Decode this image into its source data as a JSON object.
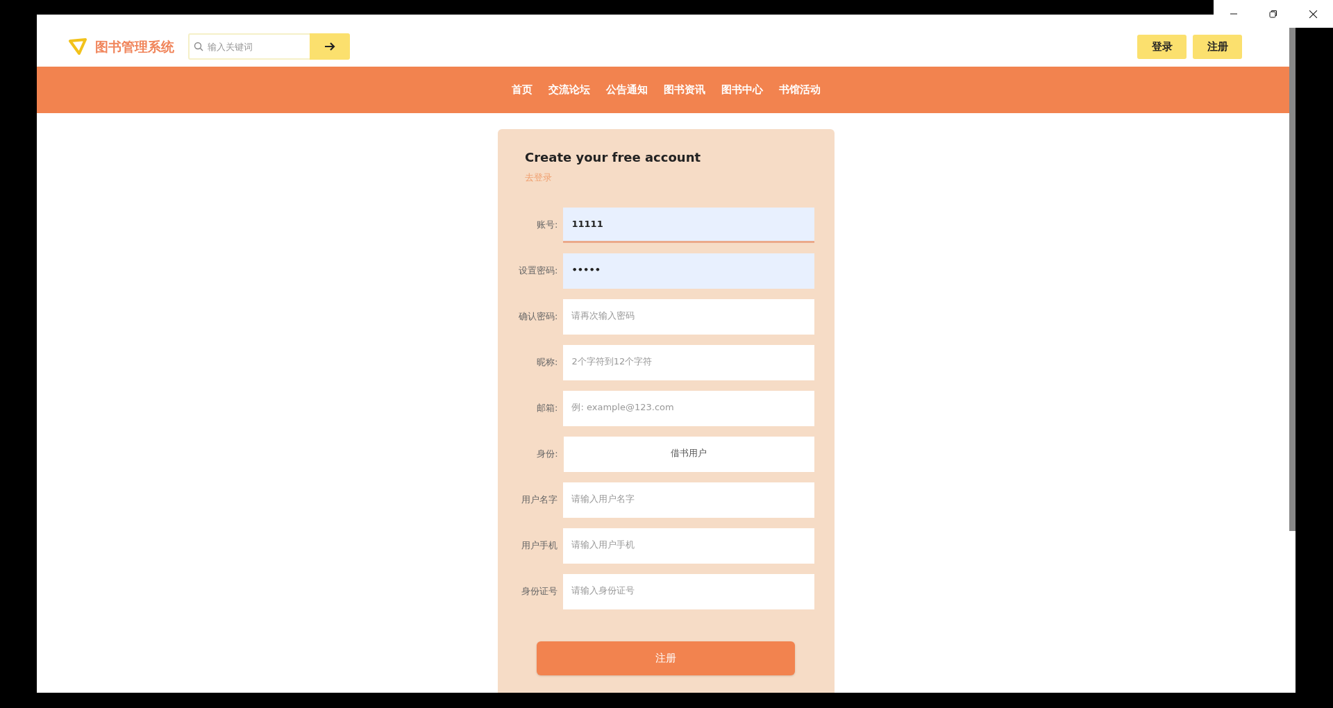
{
  "header": {
    "logo_text": "图书管理系统",
    "search": {
      "placeholder": "输入关键词"
    },
    "buttons": [
      "登录",
      "注册"
    ]
  },
  "nav": [
    {
      "label": "首页"
    },
    {
      "label": "交流论坛"
    },
    {
      "label": "公告通知"
    },
    {
      "label": "图书资讯"
    },
    {
      "label": "图书中心"
    },
    {
      "label": "书馆活动"
    }
  ],
  "form": {
    "title": "Create your free account",
    "login_link": "去登录",
    "fields": [
      {
        "kind": "text",
        "label": "账号:",
        "value": "11111",
        "autofilled": true,
        "focused": true
      },
      {
        "kind": "text",
        "label": "设置密码:",
        "value": "•••••",
        "autofilled": true,
        "focused": false
      },
      {
        "kind": "text",
        "label": "确认密码:",
        "placeholder": "请再次输入密码",
        "autofilled": false,
        "focused": false
      },
      {
        "kind": "text",
        "label": "昵称:",
        "placeholder": "2个字符到12个字符",
        "autofilled": false,
        "focused": false
      },
      {
        "kind": "text",
        "label": "邮箱:",
        "placeholder": "例: example@123.com",
        "autofilled": false,
        "focused": false
      },
      {
        "kind": "select",
        "label": "身份:",
        "value": "借书用户",
        "autofilled": false,
        "focused": false
      },
      {
        "kind": "text",
        "label": "用户名字",
        "placeholder": "请输入用户名字",
        "autofilled": false,
        "focused": false
      },
      {
        "kind": "text",
        "label": "用户手机",
        "placeholder": "请输入用户手机",
        "autofilled": false,
        "focused": false
      },
      {
        "kind": "text",
        "label": "身份证号",
        "placeholder": "请输入身份证号",
        "autofilled": false,
        "focused": false
      }
    ],
    "submit": "注册"
  }
}
